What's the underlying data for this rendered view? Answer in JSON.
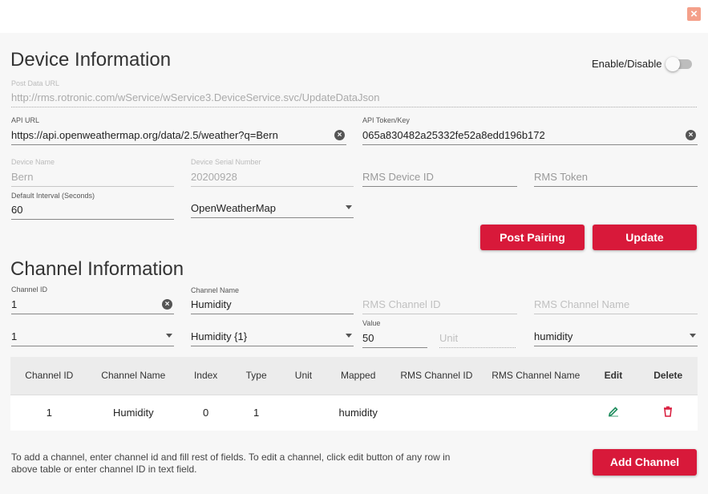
{
  "close_icon": "×",
  "device": {
    "title": "Device Information",
    "enable_label": "Enable/Disable",
    "post_url_label": "Post Data URL",
    "post_url_value": "http://rms.rotronic.com/wService/wService3.DeviceService.svc/UpdateDataJson",
    "api_url_label": "API URL",
    "api_url_value": "https://api.openweathermap.org/data/2.5/weather?q=Bern",
    "api_token_label": "API Token/Key",
    "api_token_value": "065a830482a25332fe52a8edd196b172",
    "device_name_label": "Device Name",
    "device_name_value": "Bern",
    "serial_label": "Device Serial Number",
    "serial_value": "20200928",
    "rms_device_id_placeholder": "RMS Device ID",
    "rms_token_placeholder": "RMS Token",
    "interval_label": "Default Interval (Seconds)",
    "interval_value": "60",
    "provider_value": "OpenWeatherMap",
    "post_pairing_label": "Post Pairing",
    "update_label": "Update"
  },
  "channel": {
    "title": "Channel Information",
    "channel_id_label": "Channel ID",
    "channel_id_value": "1",
    "channel_name_label": "Channel Name",
    "channel_name_value": "Humidity",
    "rms_channel_id_placeholder": "RMS Channel ID",
    "rms_channel_name_placeholder": "RMS Channel Name",
    "index_select_value": "1",
    "type_select_value": "Humidity {1}",
    "value_label": "Value",
    "value_value": "50",
    "unit_placeholder": "Unit",
    "mapped_select_value": "humidity"
  },
  "table": {
    "headers": [
      "Channel ID",
      "Channel Name",
      "Index",
      "Type",
      "Unit",
      "Mapped",
      "RMS Channel ID",
      "RMS Channel Name",
      "Edit",
      "Delete"
    ],
    "rows": [
      [
        "1",
        "Humidity",
        "0",
        "1",
        "",
        "humidity",
        "",
        ""
      ]
    ]
  },
  "help_text": "To add a channel, enter channel id and fill rest of fields. To edit a channel, click edit button of any row in above table or enter channel ID in text field.",
  "add_channel_label": "Add Channel",
  "colors": {
    "accent": "#d8193a",
    "edit_icon": "#1a8a5a",
    "delete_icon": "#d8193a"
  }
}
